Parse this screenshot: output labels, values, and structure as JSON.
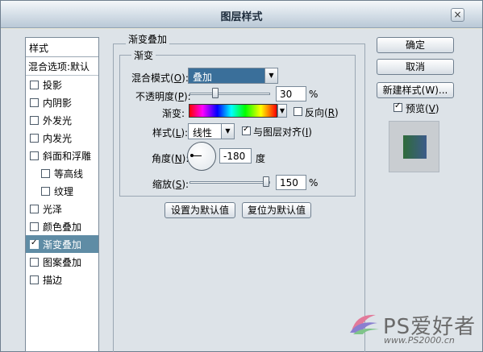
{
  "window": {
    "title": "图层样式",
    "close_glyph": "×"
  },
  "style_list": {
    "header": "样式",
    "blend_options": "混合选项:默认",
    "items": [
      {
        "label": "投影",
        "checked": false,
        "indent": false,
        "active": false
      },
      {
        "label": "内阴影",
        "checked": false,
        "indent": false,
        "active": false
      },
      {
        "label": "外发光",
        "checked": false,
        "indent": false,
        "active": false
      },
      {
        "label": "内发光",
        "checked": false,
        "indent": false,
        "active": false
      },
      {
        "label": "斜面和浮雕",
        "checked": false,
        "indent": false,
        "active": false
      },
      {
        "label": "等高线",
        "checked": false,
        "indent": true,
        "active": false
      },
      {
        "label": "纹理",
        "checked": false,
        "indent": true,
        "active": false
      },
      {
        "label": "光泽",
        "checked": false,
        "indent": false,
        "active": false
      },
      {
        "label": "颜色叠加",
        "checked": false,
        "indent": false,
        "active": false
      },
      {
        "label": "渐变叠加",
        "checked": true,
        "indent": false,
        "active": true
      },
      {
        "label": "图案叠加",
        "checked": false,
        "indent": false,
        "active": false
      },
      {
        "label": "描边",
        "checked": false,
        "indent": false,
        "active": false
      }
    ]
  },
  "panel": {
    "outer_title": "渐变叠加",
    "inner_title": "渐变",
    "blend_mode": {
      "label_pre": "混合模式(",
      "key": "O",
      "label_post": "):",
      "value": "叠加"
    },
    "opacity": {
      "label_pre": "不透明度(",
      "key": "P",
      "label_post": "):",
      "value": "30",
      "unit": "%",
      "fraction": 0.3
    },
    "gradient": {
      "label": "渐变:",
      "reverse_pre": "反向(",
      "reverse_key": "R",
      "reverse_post": ")",
      "reverse_checked": false
    },
    "style": {
      "label_pre": "样式(",
      "key": "L",
      "label_post": "):",
      "value": "线性",
      "align_pre": "与图层对齐(",
      "align_key": "I",
      "align_post": ")",
      "align_checked": true
    },
    "angle": {
      "label_pre": "角度(",
      "key": "N",
      "label_post": "):",
      "value": "-180",
      "unit": "度"
    },
    "scale": {
      "label_pre": "缩放(",
      "key": "S",
      "label_post": "):",
      "value": "150",
      "unit": "%",
      "fraction": 0.99
    },
    "set_default": "设置为默认值",
    "reset_default": "复位为默认值"
  },
  "buttons": {
    "ok": "确定",
    "cancel": "取消",
    "new_style": "新建样式(W)...",
    "preview_pre": "预览(",
    "preview_key": "V",
    "preview_post": ")",
    "preview_checked": true
  },
  "watermark": {
    "brand": "PS爱好者",
    "url": "www.PS2000.cn"
  },
  "colors": {
    "active_item": "#5f8ca5",
    "blend_select": "#3a6f9a",
    "preview_from": "#2f6b3a",
    "preview_to": "#3c5b8a"
  }
}
